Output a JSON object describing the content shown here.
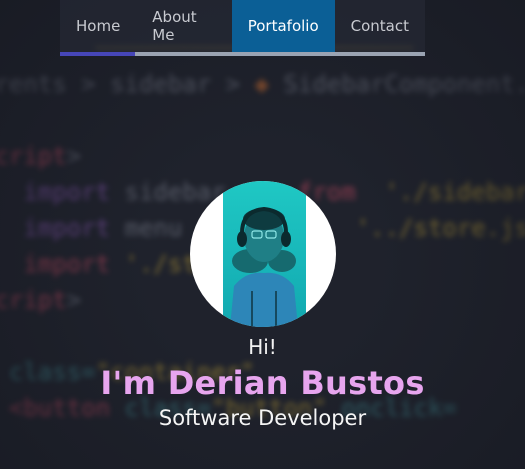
{
  "nav": {
    "items": [
      {
        "label": "Home",
        "active": false
      },
      {
        "label": "About Me",
        "active": false
      },
      {
        "label": "Portafolio",
        "active": true
      },
      {
        "label": "Contact",
        "active": false
      }
    ]
  },
  "hero": {
    "greeting": "Hi!",
    "name": "I'm Derian Bustos",
    "role": "Software Developer"
  },
  "colors": {
    "nav_active": "#0b5f96",
    "name_accent": "#e7a5ee",
    "nav_indicator": "#4646b8"
  }
}
